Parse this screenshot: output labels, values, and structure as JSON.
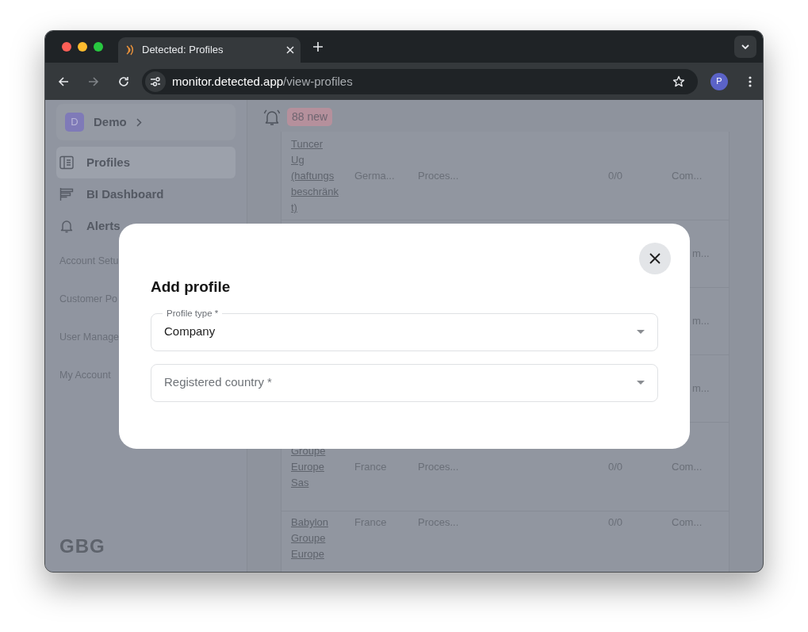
{
  "browser": {
    "tab": {
      "title": "Detected: Profiles"
    },
    "address": {
      "host": "monitor.detected.app",
      "path": "/view-profiles"
    },
    "avatar": "P"
  },
  "sidebar": {
    "org": {
      "initial": "D",
      "name": "Demo"
    },
    "items": [
      {
        "label": "Profiles",
        "selected": true,
        "kind": "main"
      },
      {
        "label": "BI Dashboard",
        "selected": false,
        "kind": "main"
      },
      {
        "label": "Alerts",
        "selected": false,
        "kind": "main"
      },
      {
        "label": "Account Setu",
        "selected": false,
        "kind": "sub"
      },
      {
        "label": "Customer Po",
        "selected": false,
        "kind": "sub"
      },
      {
        "label": "User Manage",
        "selected": false,
        "kind": "sub"
      },
      {
        "label": "My Account",
        "selected": false,
        "kind": "sub"
      }
    ],
    "logo": "GBG"
  },
  "header": {
    "badge": "88 new"
  },
  "table": {
    "rows": [
      {
        "column_1": "Tuncer Ug (haftungsbeschränkt)",
        "column_2": "Germa...",
        "column_3": "Proces...",
        "column_4": "0/0",
        "column_5": "Com..."
      },
      {
        "column_5": "m..."
      },
      {
        "column_5": "m..."
      },
      {
        "column_5": "m..."
      },
      {
        "column_1": "Groupe Europe Sas",
        "column_2": "France",
        "column_3": "Proces...",
        "column_4": "0/0",
        "column_5": "Com..."
      },
      {
        "column_1": "Babylon Groupe Europe",
        "column_2": "France",
        "column_3": "Proces...",
        "column_4": "0/0",
        "column_5": "Com..."
      }
    ]
  },
  "modal": {
    "title": "Add profile",
    "fields": [
      {
        "label": "Profile type *",
        "value": "Company"
      },
      {
        "placeholder": "Registered country *"
      }
    ]
  }
}
